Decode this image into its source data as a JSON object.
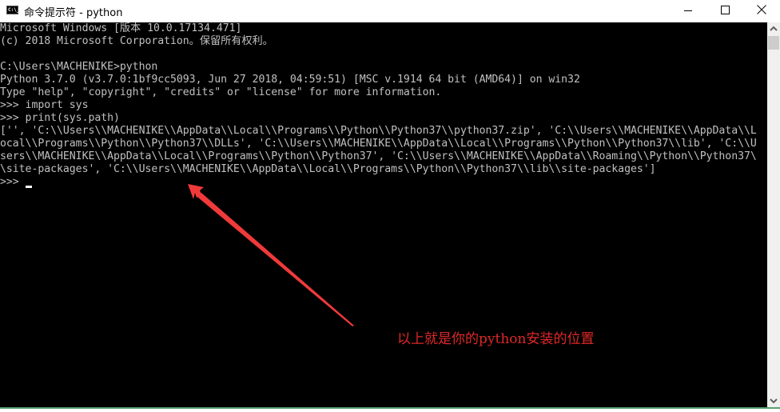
{
  "window": {
    "title": "命令提示符 - python",
    "icon": "cmd-icon",
    "icon_text": "C:\\_",
    "controls": [
      "minimize",
      "maximize",
      "close"
    ]
  },
  "console": {
    "lines": [
      "Microsoft Windows [版本 10.0.17134.471]",
      "(c) 2018 Microsoft Corporation。保留所有权利。",
      "",
      "C:\\Users\\MACHENIKE>python",
      "Python 3.7.0 (v3.7.0:1bf9cc5093, Jun 27 2018, 04:59:51) [MSC v.1914 64 bit (AMD64)] on win32",
      "Type \"help\", \"copyright\", \"credits\" or \"license\" for more information.",
      ">>> import sys",
      ">>> print(sys.path)",
      "['', 'C:\\\\Users\\\\MACHENIKE\\\\AppData\\\\Local\\\\Programs\\\\Python\\\\Python37\\\\python37.zip', 'C:\\\\Users\\\\MACHENIKE\\\\AppData\\\\L",
      "ocal\\\\Programs\\\\Python\\\\Python37\\\\DLLs', 'C:\\\\Users\\\\MACHENIKE\\\\AppData\\\\Local\\\\Programs\\\\Python\\\\Python37\\\\lib', 'C:\\\\U",
      "sers\\\\MACHENIKE\\\\AppData\\\\Local\\\\Programs\\\\Python\\\\Python37', 'C:\\\\Users\\\\MACHENIKE\\\\AppData\\\\Roaming\\\\Python\\\\Python37\\",
      "\\site-packages', 'C:\\\\Users\\\\MACHENIKE\\\\AppData\\\\Local\\\\Programs\\\\Python\\\\Python37\\\\lib\\\\site-packages']",
      ">>> "
    ]
  },
  "annotation": {
    "text": "以上就是你的python安装的位置",
    "color": "#e02828"
  },
  "colors": {
    "console_bg": "#000000",
    "console_fg": "#c0c0c0",
    "arrow": "#f03a3a"
  }
}
